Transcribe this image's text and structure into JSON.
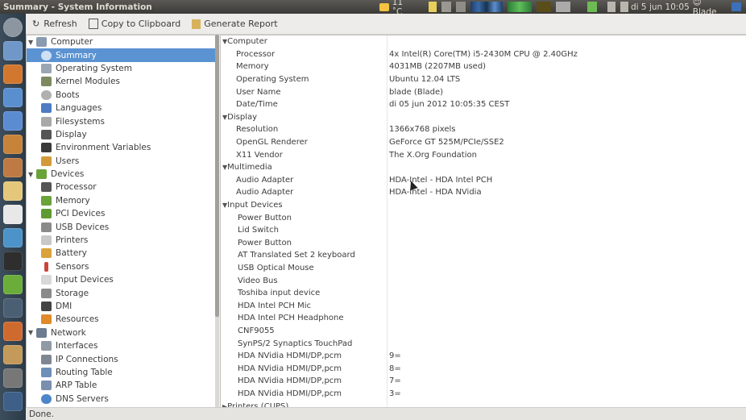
{
  "window": {
    "title": "Summary - System Information"
  },
  "panel": {
    "weather": "11 ˚C",
    "clock": "di 5 jun 10:05",
    "user": "Blade"
  },
  "toolbar": {
    "refresh": "Refresh",
    "copy": "Copy to Clipboard",
    "report": "Generate Report"
  },
  "tree": {
    "computer": "Computer",
    "computer_items": [
      "Summary",
      "Operating System",
      "Kernel Modules",
      "Boots",
      "Languages",
      "Filesystems",
      "Display",
      "Environment Variables",
      "Users"
    ],
    "devices": "Devices",
    "devices_items": [
      "Processor",
      "Memory",
      "PCI Devices",
      "USB Devices",
      "Printers",
      "Battery",
      "Sensors",
      "Input Devices",
      "Storage",
      "DMI",
      "Resources"
    ],
    "network": "Network",
    "network_items": [
      "Interfaces",
      "IP Connections",
      "Routing Table",
      "ARP Table",
      "DNS Servers"
    ]
  },
  "detail": {
    "computer": {
      "title": "Computer",
      "rows": [
        {
          "k": "Processor",
          "v": "4x Intel(R) Core(TM) i5-2430M CPU @ 2.40GHz"
        },
        {
          "k": "Memory",
          "v": "4031MB (2207MB used)"
        },
        {
          "k": "Operating System",
          "v": "Ubuntu 12.04 LTS"
        },
        {
          "k": "User Name",
          "v": "blade (Blade)"
        },
        {
          "k": "Date/Time",
          "v": "di 05 jun 2012 10:05:35 CEST"
        }
      ]
    },
    "display": {
      "title": "Display",
      "rows": [
        {
          "k": "Resolution",
          "v": "1366x768 pixels"
        },
        {
          "k": "OpenGL Renderer",
          "v": "GeForce GT 525M/PCIe/SSE2"
        },
        {
          "k": "X11 Vendor",
          "v": "The X.Org Foundation"
        }
      ]
    },
    "multimedia": {
      "title": "Multimedia",
      "rows": [
        {
          "k": "Audio Adapter",
          "v": "HDA-Intel - HDA Intel PCH"
        },
        {
          "k": "Audio Adapter",
          "v": "HDA-Intel - HDA NVidia"
        }
      ]
    },
    "input": {
      "title": "Input Devices",
      "rows": [
        {
          "k": "Power Button",
          "v": ""
        },
        {
          "k": "Lid Switch",
          "v": ""
        },
        {
          "k": "Power Button",
          "v": ""
        },
        {
          "k": "AT Translated Set 2 keyboard",
          "v": ""
        },
        {
          "k": "USB Optical Mouse",
          "v": ""
        },
        {
          "k": "Video Bus",
          "v": ""
        },
        {
          "k": "Toshiba input device",
          "v": ""
        },
        {
          "k": "HDA Intel PCH Mic",
          "v": ""
        },
        {
          "k": "HDA Intel PCH Headphone",
          "v": ""
        },
        {
          "k": "CNF9055",
          "v": ""
        },
        {
          "k": "SynPS/2 Synaptics TouchPad",
          "v": ""
        },
        {
          "k": "HDA NVidia HDMI/DP,pcm",
          "v": "9="
        },
        {
          "k": "HDA NVidia HDMI/DP,pcm",
          "v": "8="
        },
        {
          "k": "HDA NVidia HDMI/DP,pcm",
          "v": "7="
        },
        {
          "k": "HDA NVidia HDMI/DP,pcm",
          "v": "3="
        }
      ]
    },
    "printers": {
      "title": "Printers (CUPS)"
    }
  },
  "status": "Done.",
  "colors": {
    "selection": "#5b93d2",
    "panel": "#3c3b37"
  }
}
